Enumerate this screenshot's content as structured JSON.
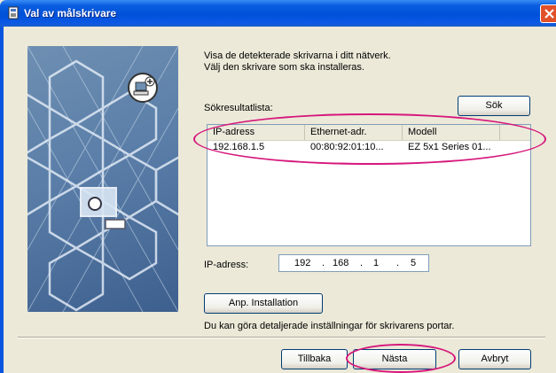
{
  "window": {
    "title": "Val av målskrivare",
    "close_icon": "close-icon"
  },
  "intro": {
    "line1": "Visa de detekterade skrivarna i ditt nätverk.",
    "line2": "Välj den skrivare som ska installeras."
  },
  "search": {
    "label": "Sökresultatlista:",
    "button": "Sök"
  },
  "table": {
    "columns": [
      "IP-adress",
      "Ethernet-adr.",
      "Modell"
    ],
    "rows": [
      {
        "ip": "192.168.1.5",
        "mac": "00:80:92:01:10...",
        "model": "EZ 5x1 Series 01..."
      }
    ]
  },
  "ip": {
    "label": "IP-adress:",
    "octets": [
      "192",
      "168",
      "1",
      "5"
    ],
    "separator": "."
  },
  "custom": {
    "button": "Anp. Installation",
    "hint": "Du kan göra detaljerade inställningar för skrivarens portar."
  },
  "footer": {
    "back": "Tillbaka",
    "next": "Nästa",
    "cancel": "Avbryt"
  },
  "colors": {
    "titlebar": "#0050d8",
    "highlight": "#d6177c"
  }
}
